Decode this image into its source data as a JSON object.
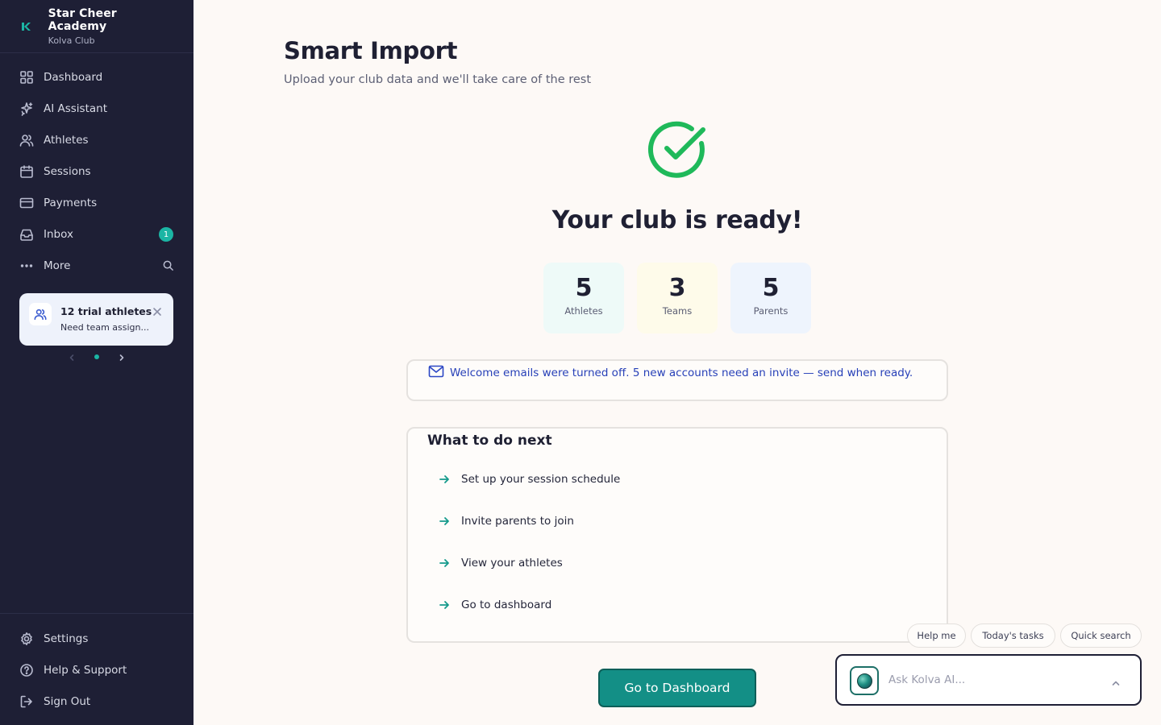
{
  "brand": {
    "name": "Star Cheer Academy",
    "subtitle": "Kolva Club",
    "accent": "#1bb5a4"
  },
  "sidebar": {
    "items": [
      {
        "label": "Dashboard",
        "icon": "dashboard-grid-icon"
      },
      {
        "label": "AI Assistant",
        "icon": "sparkles-icon"
      },
      {
        "label": "Athletes",
        "icon": "users-icon"
      },
      {
        "label": "Sessions",
        "icon": "calendar-icon"
      },
      {
        "label": "Payments",
        "icon": "credit-card-icon"
      },
      {
        "label": "Inbox",
        "icon": "inbox-icon",
        "badge": "1"
      },
      {
        "label": "More",
        "icon": "more-dots-icon"
      }
    ],
    "bottom_items": [
      {
        "label": "Settings",
        "icon": "gear-icon"
      },
      {
        "label": "Help & Support",
        "icon": "help-circle-icon"
      },
      {
        "label": "Sign Out",
        "icon": "sign-out-icon"
      }
    ]
  },
  "trial_card": {
    "title": "12 trial athletes",
    "subtitle": "Need team assign..."
  },
  "main": {
    "title": "Smart Import",
    "subtitle": "Upload your club data and we'll take care of the rest",
    "ready_message": "Your club is ready!",
    "stats": [
      {
        "value": "5",
        "label": "Athletes",
        "bg": "#eefaf8"
      },
      {
        "value": "3",
        "label": "Teams",
        "bg": "#fefbea"
      },
      {
        "value": "5",
        "label": "Parents",
        "bg": "#eef4fd"
      }
    ],
    "notice": "Welcome emails were turned off. 5 new accounts need an invite — send when ready.",
    "next_title": "What to do next",
    "next_steps": [
      "Set up your session schedule",
      "Invite parents to join",
      "View your athletes",
      "Go to dashboard"
    ],
    "cta_label": "Go to Dashboard"
  },
  "assistant": {
    "chips": [
      "Help me",
      "Today's tasks",
      "Quick search"
    ],
    "placeholder": "Ask Kolva AI..."
  }
}
